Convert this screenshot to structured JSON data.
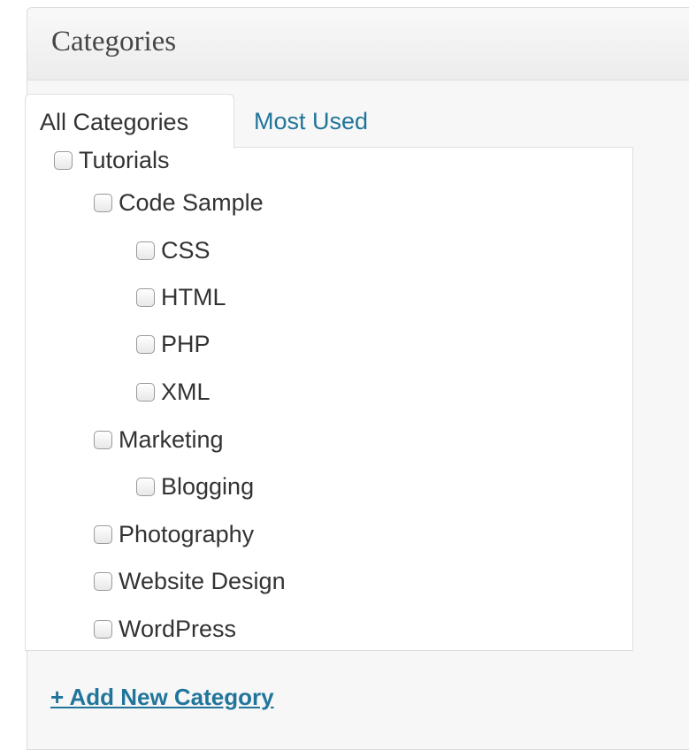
{
  "panel": {
    "title": "Categories"
  },
  "tabs": [
    {
      "label": "All Categories",
      "active": true
    },
    {
      "label": "Most Used",
      "active": false
    }
  ],
  "categories": [
    {
      "label": "Tutorials",
      "checked": false
    },
    {
      "label": "Code Sample",
      "checked": false
    },
    {
      "label": "CSS",
      "checked": false
    },
    {
      "label": "HTML",
      "checked": false
    },
    {
      "label": "PHP",
      "checked": false
    },
    {
      "label": "XML",
      "checked": false
    },
    {
      "label": "Marketing",
      "checked": false
    },
    {
      "label": "Blogging",
      "checked": false
    },
    {
      "label": "Photography",
      "checked": false
    },
    {
      "label": "Website Design",
      "checked": false
    },
    {
      "label": "WordPress",
      "checked": false
    }
  ],
  "add_new": {
    "label": "+ Add New Category"
  },
  "colors": {
    "link": "#21759b",
    "text": "#333333",
    "title": "#464646"
  }
}
